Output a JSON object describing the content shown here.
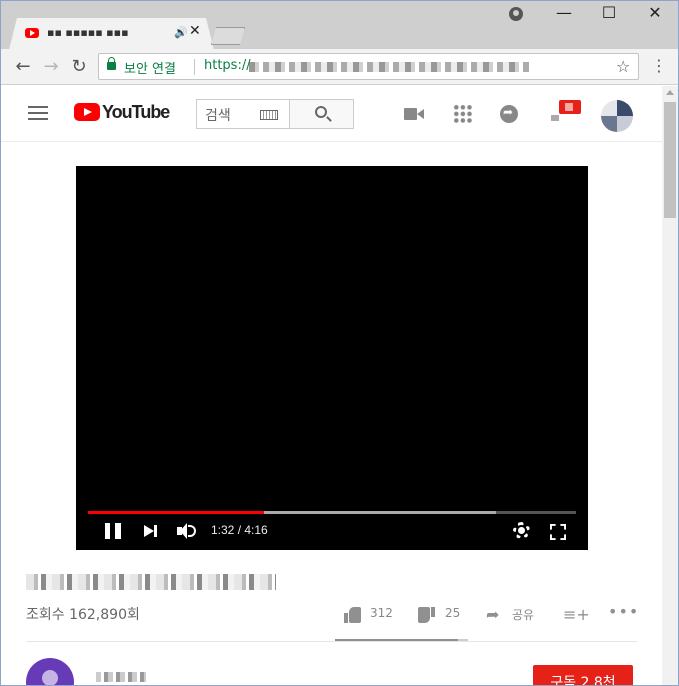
{
  "browser": {
    "tab_title": "▪▪ ▪▪▪▪▪ ▪▪▪",
    "tab_audio": "🔊",
    "tab_close": "✕",
    "back": "←",
    "forward": "→",
    "reload": "↻",
    "secure_label": "보안 연결",
    "url_prefix": "https://",
    "star": "☆",
    "menu": "⋮",
    "min": "—",
    "max": "☐",
    "close": "✕"
  },
  "youtube": {
    "wordmark": "YouTube",
    "search_placeholder": "검색"
  },
  "player": {
    "time": "1:32 / 4:16",
    "played_fraction": 0.36,
    "buffered_fraction": 0.837
  },
  "video": {
    "view_count": "조회수 162,890회",
    "likes": "312",
    "dislikes": "25",
    "share_label": "공유",
    "add_label": "≡+",
    "more_label": "•••",
    "like_fraction": 0.926
  },
  "channel": {
    "subscribe_label": "구독 2.8천"
  },
  "colors": {
    "accent": "#ff0000",
    "subscribe": "#e62117",
    "secure": "#0b8043"
  }
}
